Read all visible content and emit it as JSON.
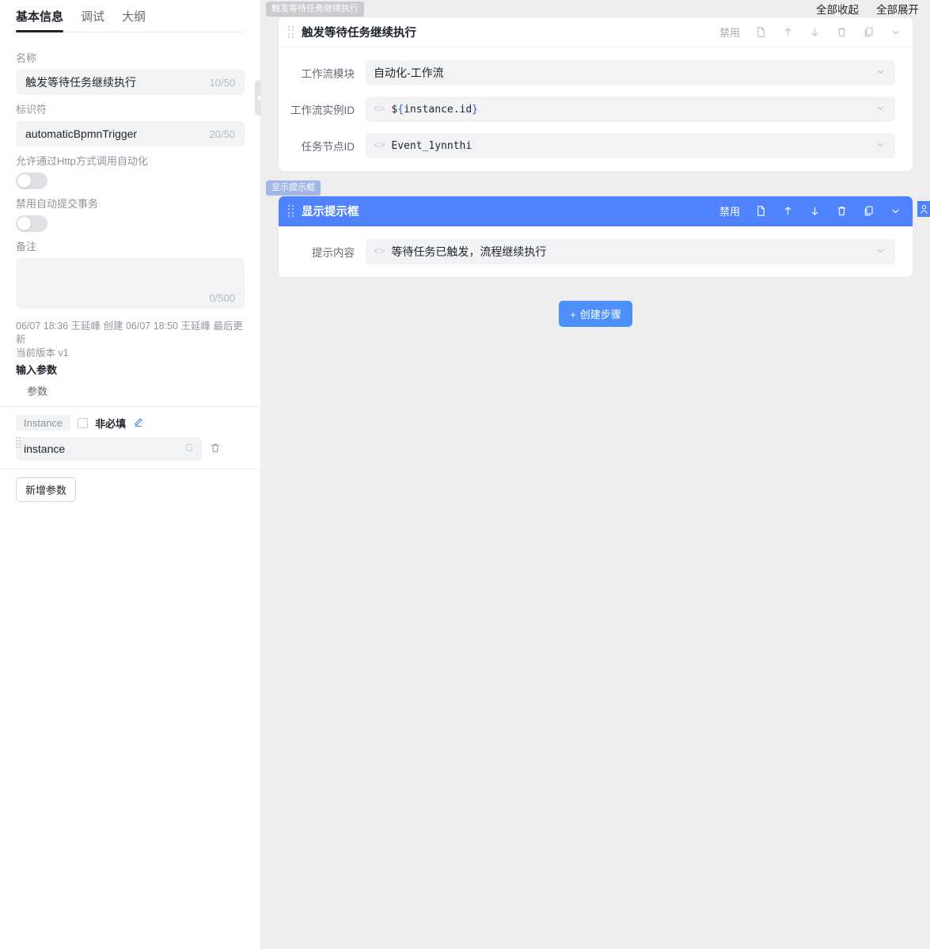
{
  "left_panel": {
    "tabs": [
      {
        "label": "基本信息",
        "active": true
      },
      {
        "label": "调试",
        "active": false
      },
      {
        "label": "大纲",
        "active": false
      }
    ],
    "name_field": {
      "label": "名称",
      "value": "触发等待任务继续执行",
      "counter": "10/50"
    },
    "key_field": {
      "label": "标识符",
      "value": "automaticBpmnTrigger",
      "counter": "20/50"
    },
    "http_toggle": {
      "label": "允许通过Http方式调用自动化",
      "state": "off"
    },
    "txn_toggle": {
      "label": "禁用自动提交事务",
      "state": "off"
    },
    "remark_field": {
      "label": "备注",
      "value": "",
      "counter": "0/500"
    },
    "meta": {
      "audit": "06/07 18:36 王延峰 创建 06/07 18:50 王延峰 最后更新",
      "version": "当前版本 v1"
    },
    "input_params": {
      "section_title": "输入参数",
      "column_header": "参数",
      "rows": [
        {
          "chip": "Instance",
          "optional_label": "非必填",
          "optional_checked": false,
          "edit_icon": "pencil-icon",
          "value": "instance",
          "copy_icon": "copy-icon",
          "delete_icon": "trash-icon"
        }
      ],
      "add_button": "新增参数"
    },
    "collapse_handle_icon": "chevron-left-icon"
  },
  "right_panel": {
    "toolbar": {
      "collapse_all": "全部收起",
      "expand_all": "全部展开"
    },
    "cursor_badge_icon": "user-cursor-icon",
    "accent_color": "#4e83fd",
    "cards": [
      {
        "tag": "触发等待任务继续执行",
        "tag_style": "gray",
        "title": "触发等待任务继续执行",
        "active": false,
        "actions": {
          "disable_label": "禁用",
          "icons": [
            "note-icon",
            "arrow-up-icon",
            "arrow-down-icon",
            "trash-icon",
            "copy-icon",
            "chevron-down-icon"
          ]
        },
        "fields": [
          {
            "label": "工作流模块",
            "value": "自动化-工作流",
            "code_icon": false,
            "mono": false
          },
          {
            "label": "工作流实例ID",
            "value": "${instance.id}",
            "code_icon": true,
            "mono": true
          },
          {
            "label": "任务节点ID",
            "value": "Event_1ynnthi",
            "code_icon": true,
            "mono": true
          }
        ]
      },
      {
        "tag": "显示提示框",
        "tag_style": "blue",
        "title": "显示提示框",
        "active": true,
        "actions": {
          "disable_label": "禁用",
          "icons": [
            "note-icon",
            "arrow-up-icon",
            "arrow-down-icon",
            "trash-icon",
            "copy-icon",
            "chevron-down-icon"
          ]
        },
        "fields": [
          {
            "label": "提示内容",
            "value": "等待任务已触发，流程继续执行",
            "code_icon": true,
            "mono": false
          }
        ]
      }
    ],
    "add_step_button": {
      "plus": "+",
      "label": "创建步骤"
    }
  }
}
